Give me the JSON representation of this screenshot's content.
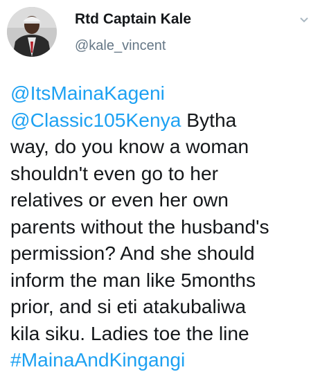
{
  "author": {
    "name": "Rtd Captain Kale",
    "handle": "@kale_vincent"
  },
  "tweet": {
    "lines": [
      [
        {
          "text": "@ItsMainaKageni",
          "link": true
        }
      ],
      [
        {
          "text": "@Classic105Kenya",
          "link": true
        },
        {
          "text": " Bytha",
          "link": false
        }
      ],
      [
        {
          "text": "way, do you know a woman",
          "link": false
        }
      ],
      [
        {
          "text": "shouldn't even go to her",
          "link": false
        }
      ],
      [
        {
          "text": "relatives or even her own",
          "link": false
        }
      ],
      [
        {
          "text": "parents without the husband's",
          "link": false
        }
      ],
      [
        {
          "text": "permission? And she should",
          "link": false
        }
      ],
      [
        {
          "text": "inform the man like 5months",
          "link": false
        }
      ],
      [
        {
          "text": "prior, and si eti atakubaliwa",
          "link": false
        }
      ],
      [
        {
          "text": "kila siku. Ladies toe the line",
          "link": false
        }
      ],
      [
        {
          "text": "#MainaAndKingangi",
          "link": true
        }
      ]
    ]
  },
  "colors": {
    "link": "#1da1f2",
    "handle": "#657786",
    "text": "#14171a"
  },
  "icons": {
    "menu": "chevron-down-icon"
  }
}
